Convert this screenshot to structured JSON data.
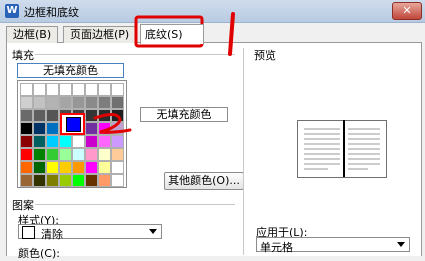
{
  "window": {
    "title": "边框和底纹",
    "close_label": "✕"
  },
  "tabs": [
    {
      "label": "边框(B)"
    },
    {
      "label": "页面边框(P)"
    },
    {
      "label": "底纹(S)",
      "active": true
    }
  ],
  "fill": {
    "group_label": "填充",
    "no_fill_button": "无填充颜色",
    "selected_color_name": "无填充颜色",
    "other_colors_button": "其他颜色(O)...",
    "selected_color": "#0000ff",
    "palette": [
      [
        "#ffffff",
        "#ffffff",
        "#ffffff",
        "#ffffff",
        "#ffffff",
        "#ffffff",
        "#ffffff",
        "#ffffff"
      ],
      [
        "#cfcfcf",
        "#c2c2c2",
        "#b3b3b3",
        "#a5a5a5",
        "#979797",
        "#8a8a8a",
        "#7d7d7d",
        "#707070"
      ],
      [
        "#6a6a6a",
        "#5f5f5f",
        "#555555",
        "#4a4a4a",
        "#404040",
        "#353535",
        "#2b2b2b",
        "#202020"
      ],
      [
        "#000000",
        "#003366",
        "#0070c0",
        "#0000ff",
        "#00b0f0",
        "#7030a0",
        "#ff00ff",
        "#c0a0d0"
      ],
      [
        "#8b0000",
        "#006060",
        "#00ccff",
        "#00ffff",
        "#ffffff",
        "#cc00cc",
        "#ff66ff",
        "#cc99ff"
      ],
      [
        "#ff0000",
        "#008000",
        "#33cc33",
        "#99ff99",
        "#ccffff",
        "#ff99cc",
        "#ffffcc",
        "#ffcc99"
      ],
      [
        "#ff6600",
        "#006600",
        "#ffff00",
        "#ffcc00",
        "#ff9900",
        "#ff00ff",
        "#ffff99",
        "#ffffff"
      ],
      [
        "#996633",
        "#333300",
        "#808000",
        "#99cc00",
        "#00ff00",
        "#663300",
        "#ff9966",
        "#ffffff"
      ]
    ]
  },
  "preview": {
    "group_label": "预览"
  },
  "pattern": {
    "group_label": "图案",
    "style_label": "样式(Y):",
    "style_value": "清除",
    "color_label": "颜色(C):"
  },
  "apply": {
    "label": "应用于(L):",
    "value": "单元格"
  },
  "annotations": {
    "mark_one": "1",
    "mark_two": "2",
    "color": "#e00000"
  }
}
